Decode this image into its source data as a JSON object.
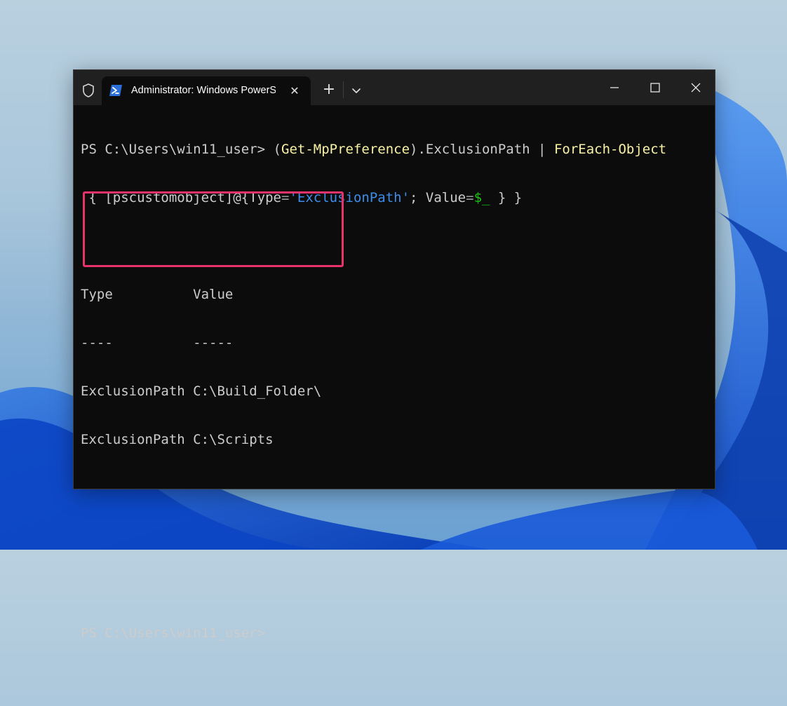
{
  "window": {
    "tab_title": "Administrator: Windows PowerShell",
    "new_tab_symbol": "+",
    "close_symbol": "✕"
  },
  "terminal": {
    "line1": {
      "prompt": "PS C:\\Users\\win11_user> ",
      "paren_open": "(",
      "cmd1": "Get-MpPreference",
      "paren_close_prop": ").ExclusionPath | ",
      "cmd2": "ForEach-Object"
    },
    "line2": {
      "part1": " { [pscustomobject]@{Type",
      "eq1": "=",
      "string": "'ExclusionPath'",
      "part2": "; Value",
      "eq2": "=",
      "var": "$_",
      "part3": "} }"
    },
    "output": {
      "header": "Type          Value",
      "underline": "----          -----",
      "rows": [
        "ExclusionPath C:\\Build_Folder\\",
        "ExclusionPath C:\\Scripts"
      ]
    },
    "prompt2": "PS C:\\Users\\win11_user>"
  },
  "colors": {
    "highlight_box": "#e8336a",
    "cmdlet": "#f9f1a5",
    "string": "#3b8eea",
    "variable": "#16c60c"
  }
}
